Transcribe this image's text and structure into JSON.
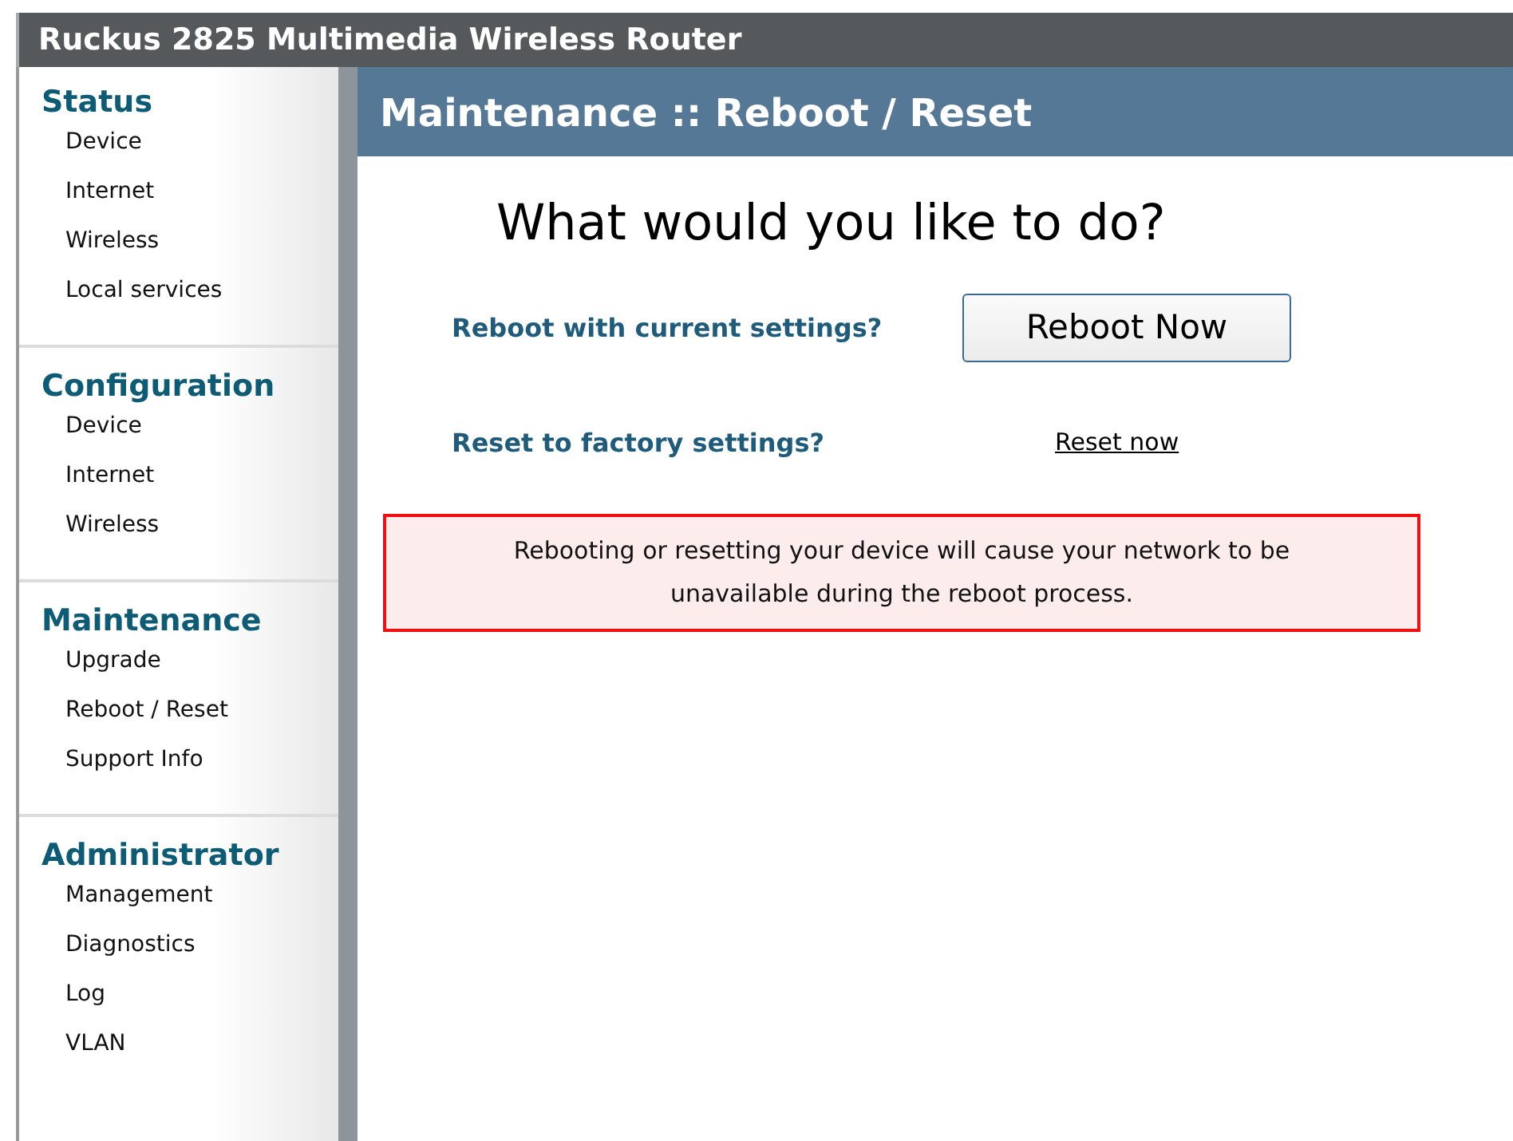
{
  "window": {
    "title": "Ruckus 2825 Multimedia Wireless Router"
  },
  "sidebar": {
    "sections": [
      {
        "heading": "Status",
        "items": [
          "Device",
          "Internet",
          "Wireless",
          "Local services"
        ]
      },
      {
        "heading": "Configuration",
        "items": [
          "Device",
          "Internet",
          "Wireless"
        ]
      },
      {
        "heading": "Maintenance",
        "items": [
          "Upgrade",
          "Reboot / Reset",
          "Support Info"
        ]
      },
      {
        "heading": "Administrator",
        "items": [
          "Management",
          "Diagnostics",
          "Log",
          "VLAN"
        ]
      }
    ]
  },
  "page": {
    "title": "Maintenance :: Reboot / Reset",
    "question": "What would you like to do?",
    "actions": [
      {
        "label": "Reboot with current settings?",
        "kind": "button",
        "control": "Reboot Now"
      },
      {
        "label": "Reset to factory settings?",
        "kind": "link",
        "control": "Reset now"
      }
    ],
    "warning": "Rebooting or resetting your device will cause your network to be unavailable during the reboot process."
  }
}
